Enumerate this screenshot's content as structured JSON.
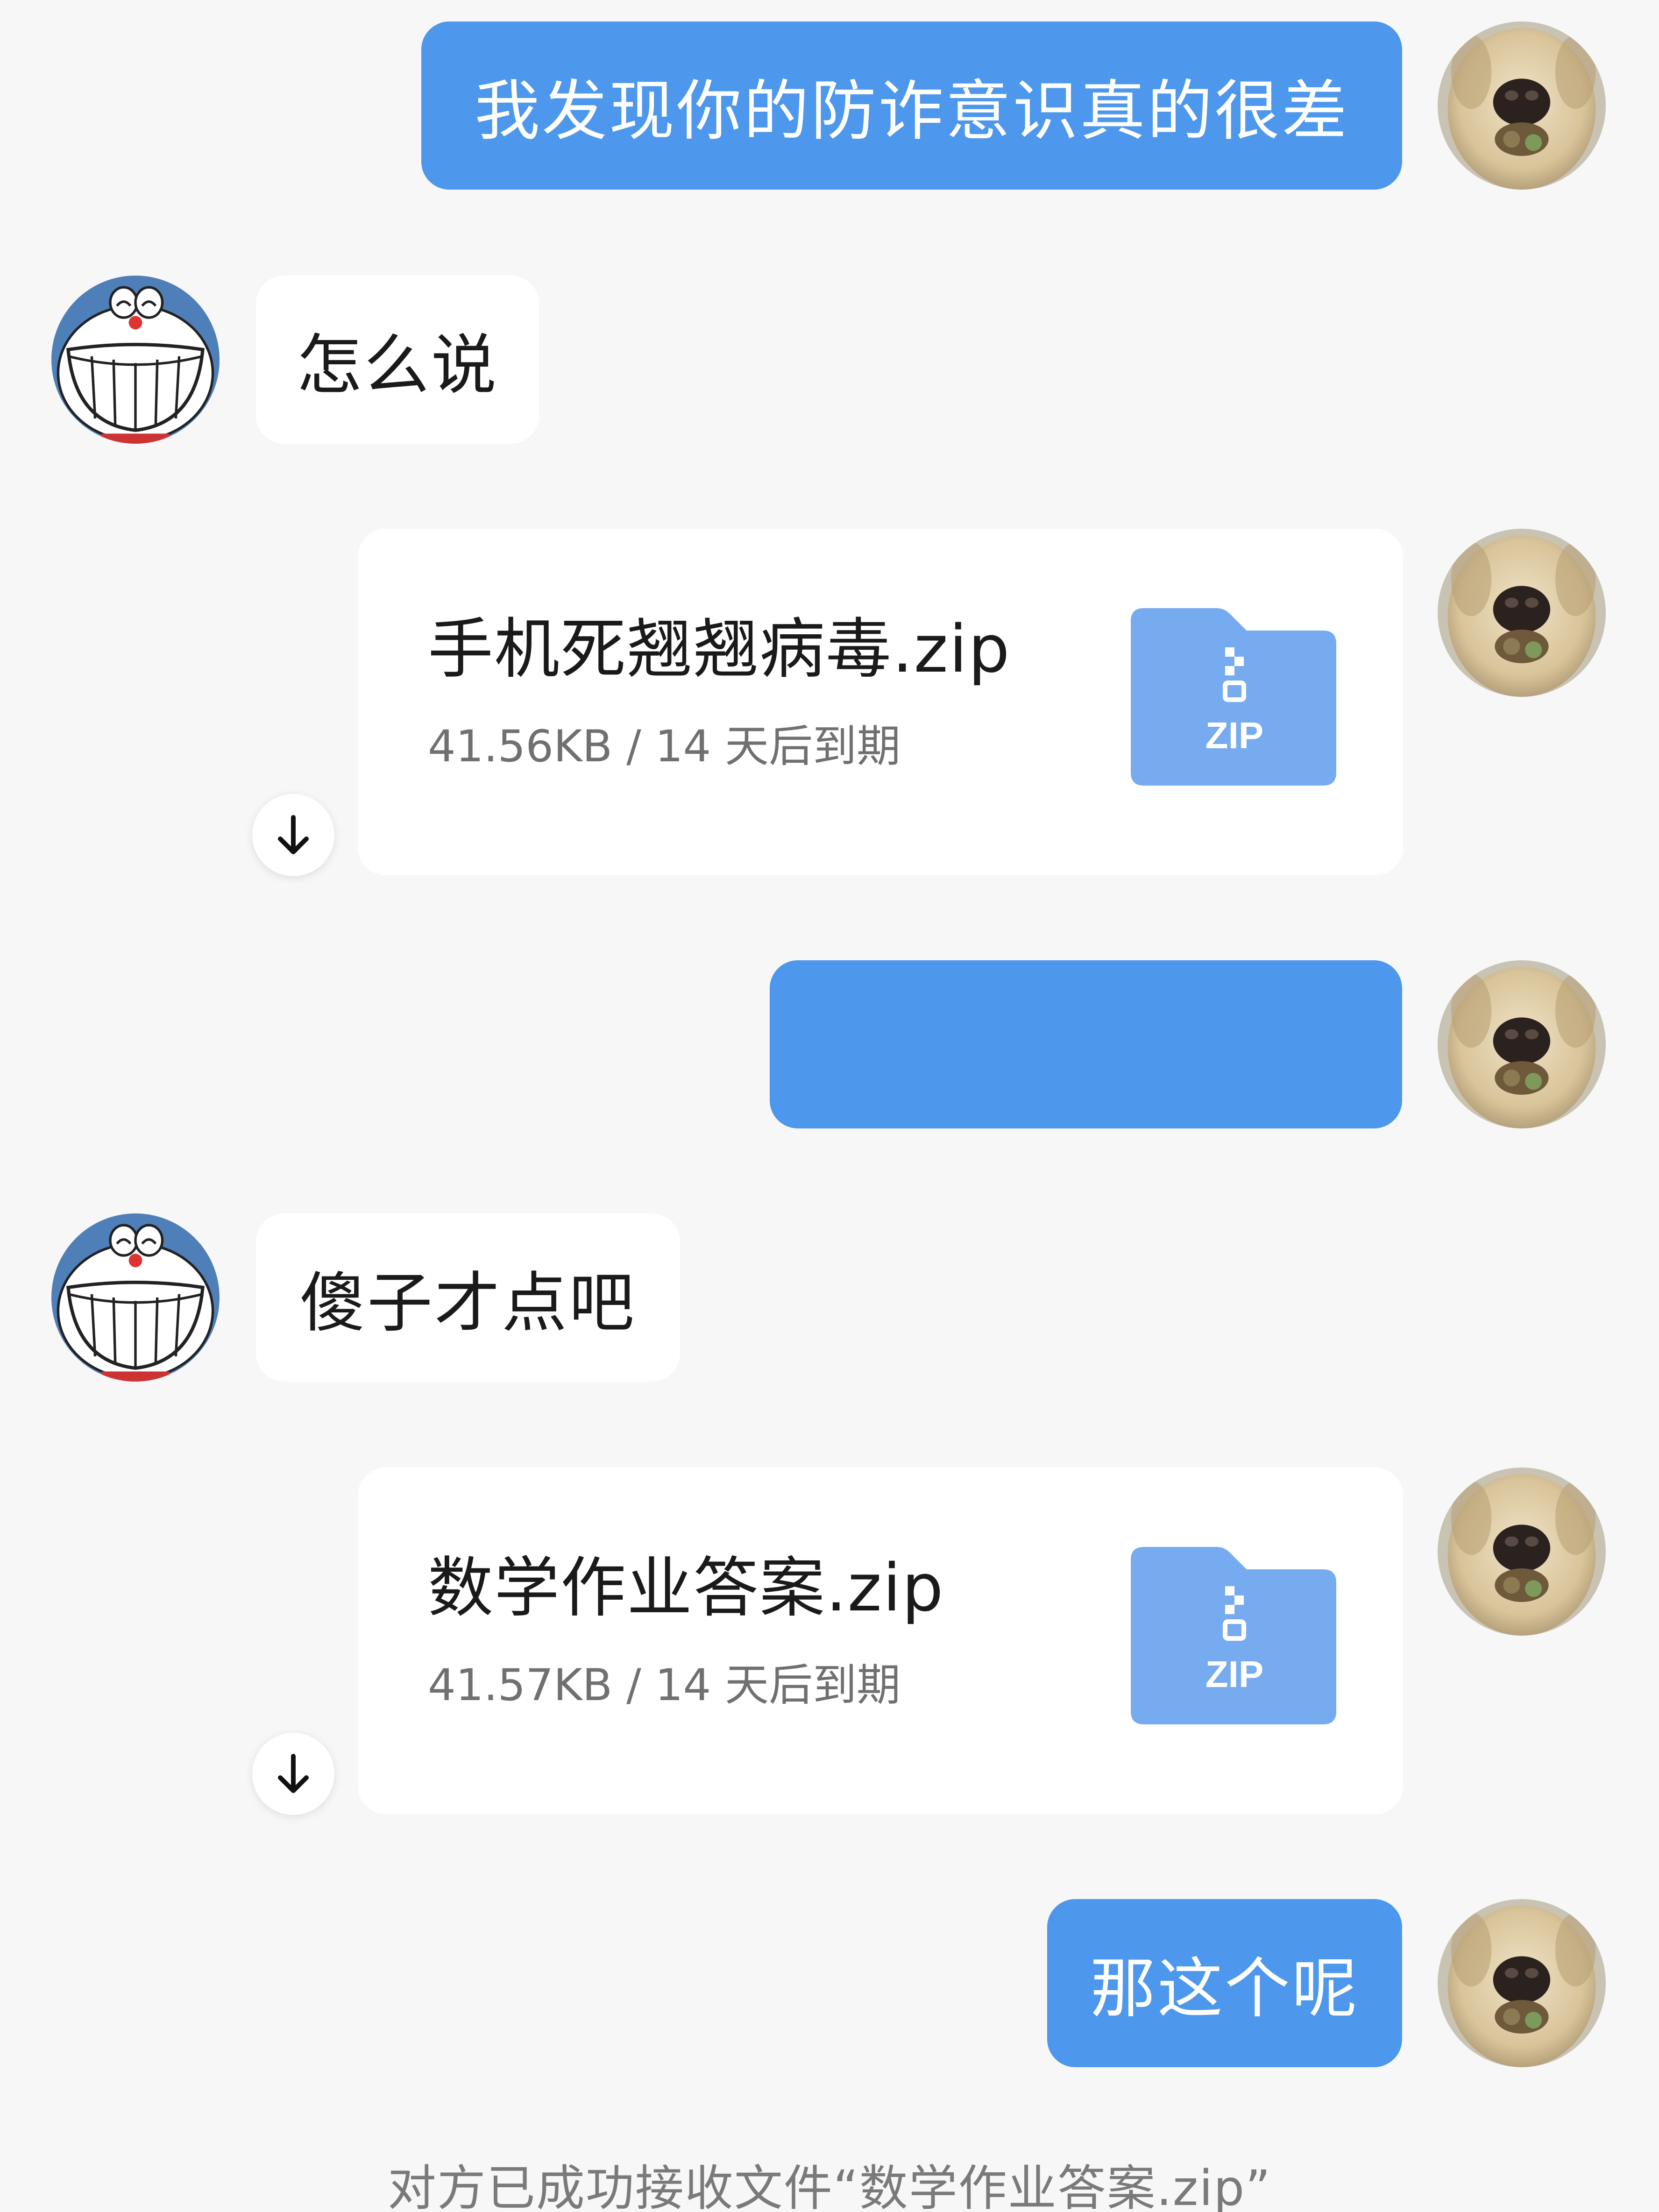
{
  "messages": {
    "m1": {
      "text": "我发现你的防诈意识真的很差",
      "sender": "me"
    },
    "m2": {
      "text": "怎么说",
      "sender": "friend"
    },
    "f1": {
      "file_name": "手机死翘翘病毒.zip",
      "meta": "41.56KB / 14 天后到期",
      "file_type": "ZIP",
      "sender": "me"
    },
    "m3": {
      "text": "",
      "sender": "me"
    },
    "m4": {
      "text": "傻子才点吧",
      "sender": "friend"
    },
    "f2": {
      "file_name": "数学作业答案.zip",
      "meta": "41.57KB / 14 天后到期",
      "file_type": "ZIP",
      "sender": "me"
    },
    "m5": {
      "text": "那这个呢",
      "sender": "me"
    }
  },
  "status": {
    "text": "对方已成功接收文件“数学作业答案.zip”"
  },
  "icons": {
    "my_avatar": "dog-avatar-icon",
    "friend_avatar": "doraemon-avatar-icon",
    "file": "zip-file-icon",
    "download": "download-arrow-icon"
  },
  "colors": {
    "background": "#f7f7f7",
    "my_bubble": "#4d97ec",
    "friend_bubble": "#ffffff",
    "zip_icon": "#76acef",
    "meta_text": "#707070"
  }
}
